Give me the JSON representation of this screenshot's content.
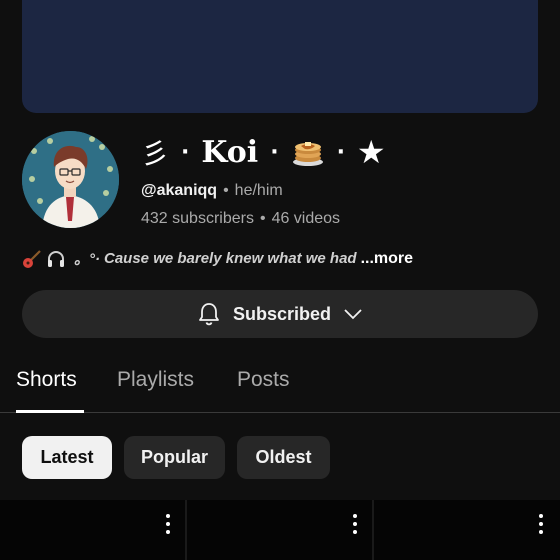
{
  "channel": {
    "name_prefix_glyph": "彡",
    "separator": "·",
    "name": "Koi",
    "handle": "@akaniqq",
    "pronouns": "he/him",
    "subscribers": "432 subscribers",
    "videos": "46 videos",
    "bio_symbols": "。°·",
    "bio_text": "Cause we barely knew what we had",
    "bio_more": "...more"
  },
  "actions": {
    "subscribed_label": "Subscribed"
  },
  "tabs": [
    {
      "label": "Shorts",
      "active": true
    },
    {
      "label": "Playlists",
      "active": false
    },
    {
      "label": "Posts",
      "active": false
    }
  ],
  "filters": [
    {
      "label": "Latest",
      "active": true
    },
    {
      "label": "Popular",
      "active": false
    },
    {
      "label": "Oldest",
      "active": false
    }
  ],
  "icons": {
    "bio_emoji_1": "guitar-icon",
    "bio_emoji_2": "headphones-icon",
    "name_emoji": "pancakes-icon",
    "name_star": "star-icon",
    "bell": "bell-icon",
    "chevron": "chevron-down-icon",
    "kebab": "more-vert-icon"
  },
  "colors": {
    "background": "#0f0f0f",
    "banner": "#1c2642",
    "button": "#272727",
    "active_chip": "#f1f1f1"
  }
}
